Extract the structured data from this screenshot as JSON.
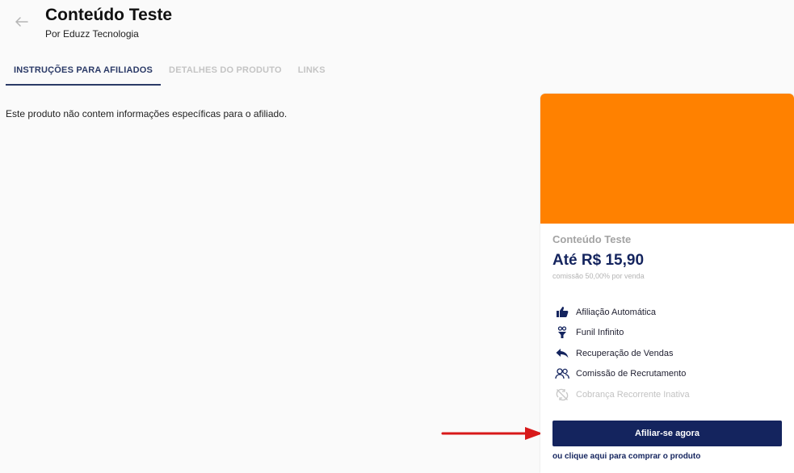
{
  "header": {
    "back_icon": "arrow-left-icon",
    "title": "Conteúdo Teste",
    "subtitle": "Por Eduzz Tecnologia"
  },
  "tabs": [
    {
      "label": "INSTRUÇÕES PARA AFILIADOS",
      "active": true
    },
    {
      "label": "DETALHES DO PRODUTO",
      "active": false
    },
    {
      "label": "LINKS",
      "active": false
    }
  ],
  "main": {
    "message": "Este produto não contem informações específicas para o afiliado."
  },
  "card": {
    "image_color": "#ff8100",
    "title": "Conteúdo Teste",
    "price": "Até R$ 15,90",
    "commission": "comissão 50,00% por venda",
    "features": [
      {
        "label": "Afiliação Automática",
        "icon": "thumbs-up-icon",
        "enabled": true
      },
      {
        "label": "Funil Infinito",
        "icon": "funnel-icon",
        "enabled": true
      },
      {
        "label": "Recuperação de Vendas",
        "icon": "reply-arrow-icon",
        "enabled": true
      },
      {
        "label": "Comissão de Recrutamento",
        "icon": "people-icon",
        "enabled": true
      },
      {
        "label": "Cobrança Recorrente Inativa",
        "icon": "sync-disabled-icon",
        "enabled": false
      }
    ],
    "cta_label": "Afiliar-se agora",
    "buy_link": "ou clique aqui para comprar o produto"
  },
  "colors": {
    "primary": "#14245e",
    "accent_orange": "#ff8100",
    "annotation_arrow": "#d8191a"
  }
}
